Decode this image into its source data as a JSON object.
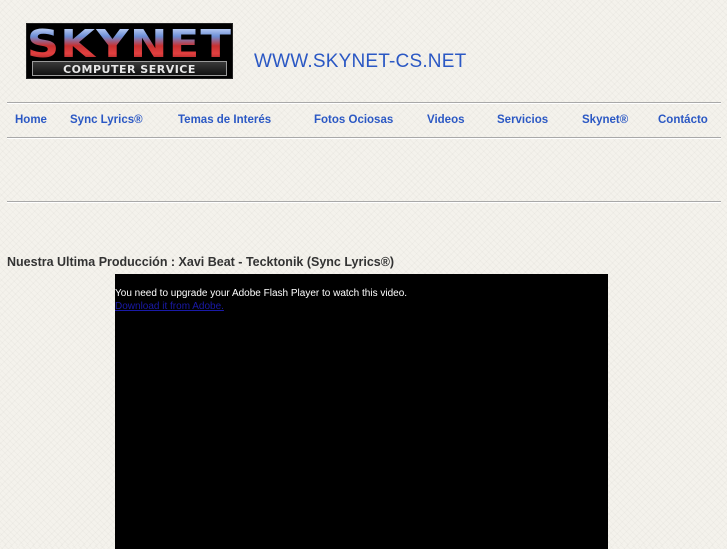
{
  "header": {
    "logo": {
      "top_text": "SKYNET",
      "bottom_text": "COMPUTER SERVICE"
    },
    "site_url": "WWW.SKYNET-CS.NET"
  },
  "nav": {
    "items": [
      {
        "label": "Home"
      },
      {
        "label": "Sync Lyrics®"
      },
      {
        "label": "Temas de Interés"
      },
      {
        "label": "Fotos Ociosas"
      },
      {
        "label": "Videos"
      },
      {
        "label": "Servicios"
      },
      {
        "label": "Skynet®"
      },
      {
        "label": "Contácto"
      }
    ]
  },
  "main": {
    "headline": "Nuestra Ultima Producción : Xavi Beat - Tecktonik (Sync Lyrics®)",
    "video": {
      "message": "You need to upgrade your Adobe Flash Player to watch this video.",
      "download_link": "Download it from Adobe."
    }
  },
  "colors": {
    "link": "#2b58c4",
    "background": "#f4f2ec",
    "video_bg": "#000000"
  }
}
